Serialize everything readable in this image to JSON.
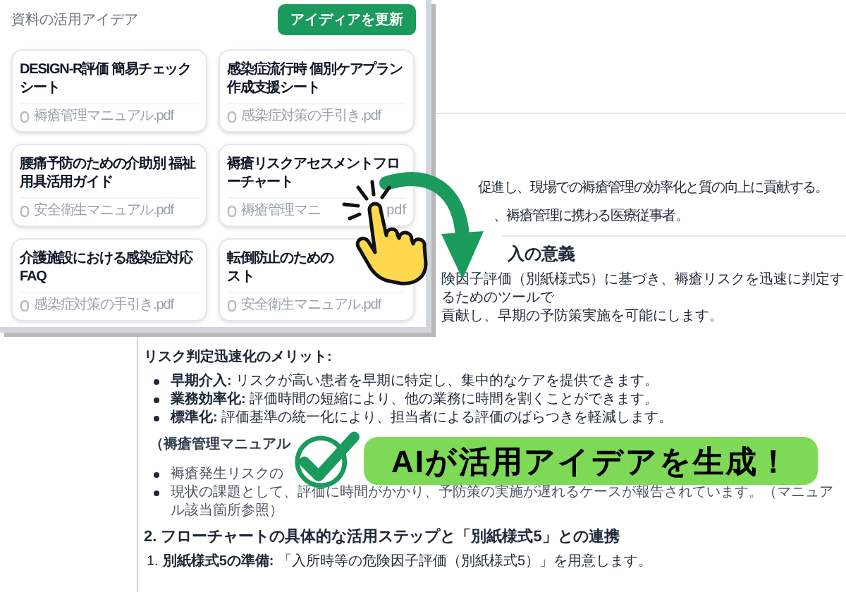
{
  "panel": {
    "title": "資料の活用アイデア",
    "button": "アイディアを更新",
    "cards": [
      {
        "title": "DESIGN-R評価 簡易チェックシート",
        "file": "褥瘡管理マニュアル.pdf"
      },
      {
        "title": "感染症流行時 個別ケアプラン作成支援シート",
        "file": "感染症対策の手引き.pdf"
      },
      {
        "title": "腰痛予防のための介助別 福祉用具活用ガイド",
        "file": "安全衛生マニュアル.pdf"
      },
      {
        "title": "褥瘡リスクアセスメントフローチャート",
        "file": "褥瘡管理マニ",
        "file_end": "pdf"
      },
      {
        "title": "介護施設における感染症対応FAQ",
        "file": "感染症対策の手引き.pdf"
      },
      {
        "title": "転倒防止のための",
        "title_end": "スト",
        "file": "安全衛生マニュアル.pdf"
      }
    ]
  },
  "document": {
    "upper_lines": [
      "促進し、現場での褥瘡管理の効率化と質の向上に貢献する。",
      "、褥瘡管理に携わる医療従事者。"
    ],
    "heading_fragment": "入の意義",
    "paragraph_lines": [
      "険因子評価（別紙様式5）に基づき、褥瘡リスクを迅速に判定するためのツールで",
      "貢献し、早期の予防策実施を可能にします。"
    ],
    "subheading": "リスク判定迅速化のメリット:",
    "benefits": [
      "**早期介入:** リスクが高い患者を早期に特定し、集中的なケアを提供できます。",
      "**業務効率化:** 評価時間の短縮により、他の業務に時間を割くことができます。",
      "**標準化:** 評価基準の統一化により、担当者による評価のばらつきを軽減します。"
    ],
    "reference": "（褥瘡管理マニュアル",
    "issues": [
      "褥瘡発生リスクの",
      "現状の課題として、評価に時間がかかり、予防策の実施が遅れるケースが報告されています。（マニュアル該当箇所参照）"
    ],
    "section_heading": "2. フローチャートの具体的な活用ステップと「別紙様式5」との連携",
    "steps": [
      {
        "number": "1.",
        "text": "**別紙様式5の準備:** 「入所時等の危険因子評価（別紙様式5）」を用意します。"
      }
    ]
  },
  "callout": {
    "text": "AIが活用アイデアを生成！"
  }
}
